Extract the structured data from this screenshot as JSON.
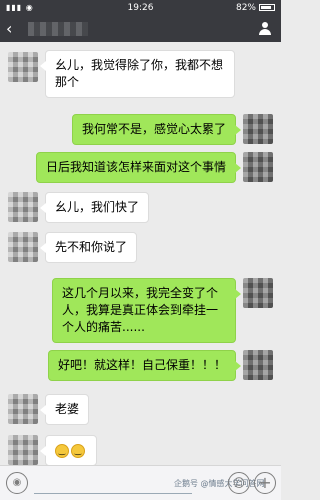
{
  "status_bar": {
    "time": "19:26",
    "battery": "82%",
    "signal": "▮▮▮ ◉"
  },
  "title_bar": {
    "back_glyph": "‹",
    "contact_name": ""
  },
  "messages": [
    {
      "side": "in",
      "text": "幺儿，我觉得除了你，我都不想那个"
    },
    {
      "side": "out",
      "text": "我何常不是，感觉心太累了"
    },
    {
      "side": "out",
      "text": "日后我知道该怎样来面对这个事情"
    },
    {
      "side": "in",
      "text": "幺儿，我们快了"
    },
    {
      "side": "in",
      "text": "先不和你说了"
    },
    {
      "side": "out",
      "text": "这几个月以来，我完全变了个人，我算是真正体会到牵挂一个人的痛苦......"
    },
    {
      "side": "out",
      "text": "好吧！就这样！自己保重！！！"
    },
    {
      "side": "in",
      "text": "老婆"
    },
    {
      "side": "in",
      "text": "",
      "emoji_count": 2
    }
  ],
  "input_bar": {
    "watermark": "企鹅号 @情感大学问答网",
    "voice_glyph": "◉",
    "emoji_glyph": "☺",
    "plus_glyph": "+"
  },
  "colors": {
    "header": "#393a3f",
    "chat_bg": "#ebebeb",
    "outgoing_bubble": "#a0e75a",
    "incoming_bubble": "#ffffff"
  }
}
